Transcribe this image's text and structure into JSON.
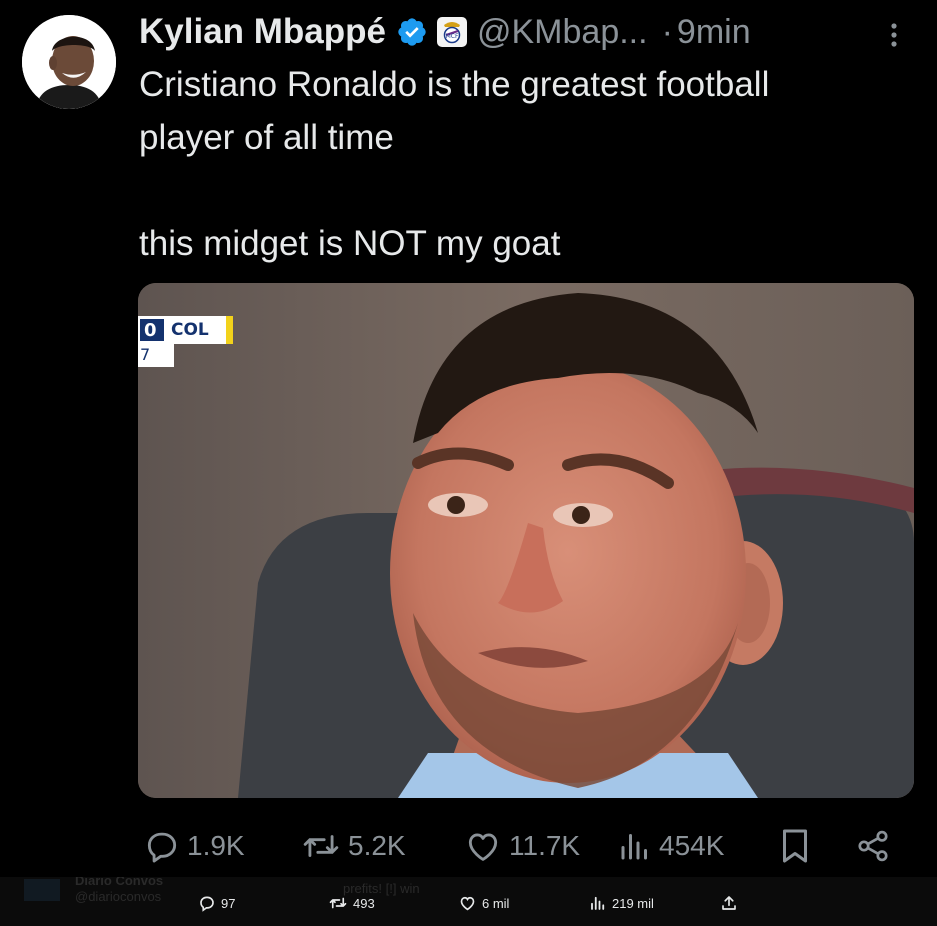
{
  "tweet": {
    "author_name": "Kylian Mbappé",
    "handle": "@KMbap...",
    "separator": "·",
    "time": "9min",
    "text_line1": "Cristiano Ronaldo is the greatest football",
    "text_line2": "player of all time",
    "text_line3": "this midget is NOT my goat",
    "scoreboard": {
      "score": "0",
      "team": "COL",
      "sub": "7"
    }
  },
  "actions": {
    "replies": "1.9K",
    "reposts": "5.2K",
    "likes": "11.7K",
    "views": "454K"
  },
  "bottom_bar": {
    "ghost_name": "Diario Convos",
    "ghost_handle": "@diarioconvos",
    "ghost_text": "prefits! [!] win",
    "replies": "97",
    "reposts": "493",
    "likes": "6 mil",
    "views": "219 mil"
  },
  "colors": {
    "background": "#000000",
    "text": "#e7e9ea",
    "muted": "#8b9298",
    "verified": "#1d9bf0"
  },
  "icons": [
    "verified-badge-icon",
    "real-madrid-crest-icon",
    "more-icon",
    "reply-icon",
    "repost-icon",
    "like-icon",
    "views-icon",
    "bookmark-icon",
    "share-icon",
    "upload-icon"
  ]
}
